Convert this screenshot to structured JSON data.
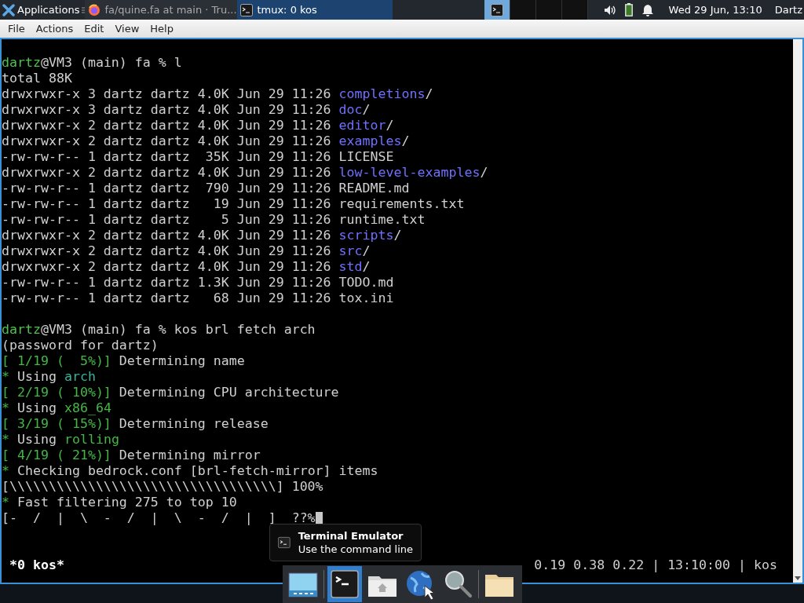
{
  "taskbar": {
    "apps_menu": "Applications",
    "windows": [
      {
        "title": "fa/quine.fa at main · Tru...",
        "kind": "browser",
        "selected": false
      },
      {
        "title": "tmux: 0 kos",
        "kind": "terminal",
        "selected": true
      }
    ],
    "workspaces": [
      {
        "selected": true
      },
      {
        "selected": false
      },
      {
        "selected": false
      },
      {
        "selected": false
      }
    ],
    "clock": "Wed 29 Jun, 13:10",
    "user": "Dartz"
  },
  "menu": [
    "File",
    "Actions",
    "Edit",
    "View",
    "Help"
  ],
  "terminal": {
    "lines": [
      {
        "blank_before": true,
        "segments": [
          {
            "text": "dartz",
            "kind": "user"
          },
          {
            "text": "@VM3 (main) fa % l",
            "kind": "plain"
          }
        ]
      },
      {
        "segments": [
          {
            "text": "total 88K",
            "kind": "plain"
          }
        ]
      },
      {
        "segments": [
          {
            "text": "drwxrwxr-x 3 dartz dartz 4.0K Jun 29 11:26 ",
            "kind": "plain"
          },
          {
            "text": "completions",
            "kind": "dir"
          },
          {
            "text": "/",
            "kind": "plain"
          }
        ]
      },
      {
        "segments": [
          {
            "text": "drwxrwxr-x 3 dartz dartz 4.0K Jun 29 11:26 ",
            "kind": "plain"
          },
          {
            "text": "doc",
            "kind": "dir"
          },
          {
            "text": "/",
            "kind": "plain"
          }
        ]
      },
      {
        "segments": [
          {
            "text": "drwxrwxr-x 2 dartz dartz 4.0K Jun 29 11:26 ",
            "kind": "plain"
          },
          {
            "text": "editor",
            "kind": "dir"
          },
          {
            "text": "/",
            "kind": "plain"
          }
        ]
      },
      {
        "segments": [
          {
            "text": "drwxrwxr-x 2 dartz dartz 4.0K Jun 29 11:26 ",
            "kind": "plain"
          },
          {
            "text": "examples",
            "kind": "dir"
          },
          {
            "text": "/",
            "kind": "plain"
          }
        ]
      },
      {
        "segments": [
          {
            "text": "-rw-rw-r-- 1 dartz dartz  35K Jun 29 11:26 LICENSE",
            "kind": "plain"
          }
        ]
      },
      {
        "segments": [
          {
            "text": "drwxrwxr-x 2 dartz dartz 4.0K Jun 29 11:26 ",
            "kind": "plain"
          },
          {
            "text": "low-level-examples",
            "kind": "dir"
          },
          {
            "text": "/",
            "kind": "plain"
          }
        ]
      },
      {
        "segments": [
          {
            "text": "-rw-rw-r-- 1 dartz dartz  790 Jun 29 11:26 README.md",
            "kind": "plain"
          }
        ]
      },
      {
        "segments": [
          {
            "text": "-rw-rw-r-- 1 dartz dartz   19 Jun 29 11:26 requirements.txt",
            "kind": "plain"
          }
        ]
      },
      {
        "segments": [
          {
            "text": "-rw-rw-r-- 1 dartz dartz    5 Jun 29 11:26 runtime.txt",
            "kind": "plain"
          }
        ]
      },
      {
        "segments": [
          {
            "text": "drwxrwxr-x 2 dartz dartz 4.0K Jun 29 11:26 ",
            "kind": "plain"
          },
          {
            "text": "scripts",
            "kind": "dir"
          },
          {
            "text": "/",
            "kind": "plain"
          }
        ]
      },
      {
        "segments": [
          {
            "text": "drwxrwxr-x 2 dartz dartz 4.0K Jun 29 11:26 ",
            "kind": "plain"
          },
          {
            "text": "src",
            "kind": "dir"
          },
          {
            "text": "/",
            "kind": "plain"
          }
        ]
      },
      {
        "segments": [
          {
            "text": "drwxrwxr-x 2 dartz dartz 4.0K Jun 29 11:26 ",
            "kind": "plain"
          },
          {
            "text": "std",
            "kind": "dir"
          },
          {
            "text": "/",
            "kind": "plain"
          }
        ]
      },
      {
        "segments": [
          {
            "text": "-rw-rw-r-- 1 dartz dartz 1.3K Jun 29 11:26 TODO.md",
            "kind": "plain"
          }
        ]
      },
      {
        "segments": [
          {
            "text": "-rw-rw-r-- 1 dartz dartz   68 Jun 29 11:26 tox.ini",
            "kind": "plain"
          }
        ]
      },
      {
        "blank_before": true,
        "segments": [
          {
            "text": "dartz",
            "kind": "user"
          },
          {
            "text": "@VM3 (main) fa % kos brl fetch arch",
            "kind": "plain"
          }
        ]
      },
      {
        "segments": [
          {
            "text": "(password for dartz)",
            "kind": "plain"
          }
        ]
      },
      {
        "segments": [
          {
            "text": "[ 1/19 (  5%)]",
            "kind": "green"
          },
          {
            "text": " Determining name",
            "kind": "plain"
          }
        ]
      },
      {
        "segments": [
          {
            "text": "*",
            "kind": "green"
          },
          {
            "text": " Using ",
            "kind": "plain"
          },
          {
            "text": "arch",
            "kind": "teal"
          }
        ]
      },
      {
        "segments": [
          {
            "text": "[ 2/19 ( 10%)]",
            "kind": "green"
          },
          {
            "text": " Determining CPU architecture",
            "kind": "plain"
          }
        ]
      },
      {
        "segments": [
          {
            "text": "*",
            "kind": "green"
          },
          {
            "text": " Using ",
            "kind": "plain"
          },
          {
            "text": "x86_64",
            "kind": "green"
          }
        ]
      },
      {
        "segments": [
          {
            "text": "[ 3/19 ( 15%)]",
            "kind": "green"
          },
          {
            "text": " Determining release",
            "kind": "plain"
          }
        ]
      },
      {
        "segments": [
          {
            "text": "*",
            "kind": "green"
          },
          {
            "text": " Using ",
            "kind": "plain"
          },
          {
            "text": "rolling",
            "kind": "green"
          }
        ]
      },
      {
        "segments": [
          {
            "text": "[ 4/19 ( 21%)]",
            "kind": "green"
          },
          {
            "text": " Determining mirror",
            "kind": "plain"
          }
        ]
      },
      {
        "segments": [
          {
            "text": "*",
            "kind": "green"
          },
          {
            "text": " Checking bedrock.conf [brl-fetch-mirror] items",
            "kind": "plain"
          }
        ]
      },
      {
        "segments": [
          {
            "text": "[\\\\\\\\\\\\\\\\\\\\\\\\\\\\\\\\\\\\\\\\\\\\\\\\\\\\\\\\\\\\\\\\\\\\] 100%",
            "kind": "plain"
          }
        ]
      },
      {
        "segments": [
          {
            "text": "*",
            "kind": "green"
          },
          {
            "text": " Fast filtering 275 to top 10",
            "kind": "plain"
          }
        ]
      },
      {
        "cursor": true,
        "segments": [
          {
            "text": "[-  /  |  \\  -  /  |  \\  -  /  |  ]  ??%",
            "kind": "plain"
          }
        ]
      }
    ]
  },
  "status_bar": {
    "left": "*0 kos*",
    "right": "0.19 0.38 0.22 | 13:10:00 | kos"
  },
  "tooltip": {
    "title": "Terminal Emulator",
    "description": "Use the command line"
  },
  "dock": [
    {
      "kind": "desktop",
      "selected": false
    },
    {
      "kind": "terminal",
      "selected": true
    },
    {
      "kind": "home",
      "selected": false
    },
    {
      "kind": "web",
      "selected": false
    },
    {
      "kind": "search",
      "selected": false
    },
    {
      "kind": "folder",
      "selected": false
    }
  ]
}
